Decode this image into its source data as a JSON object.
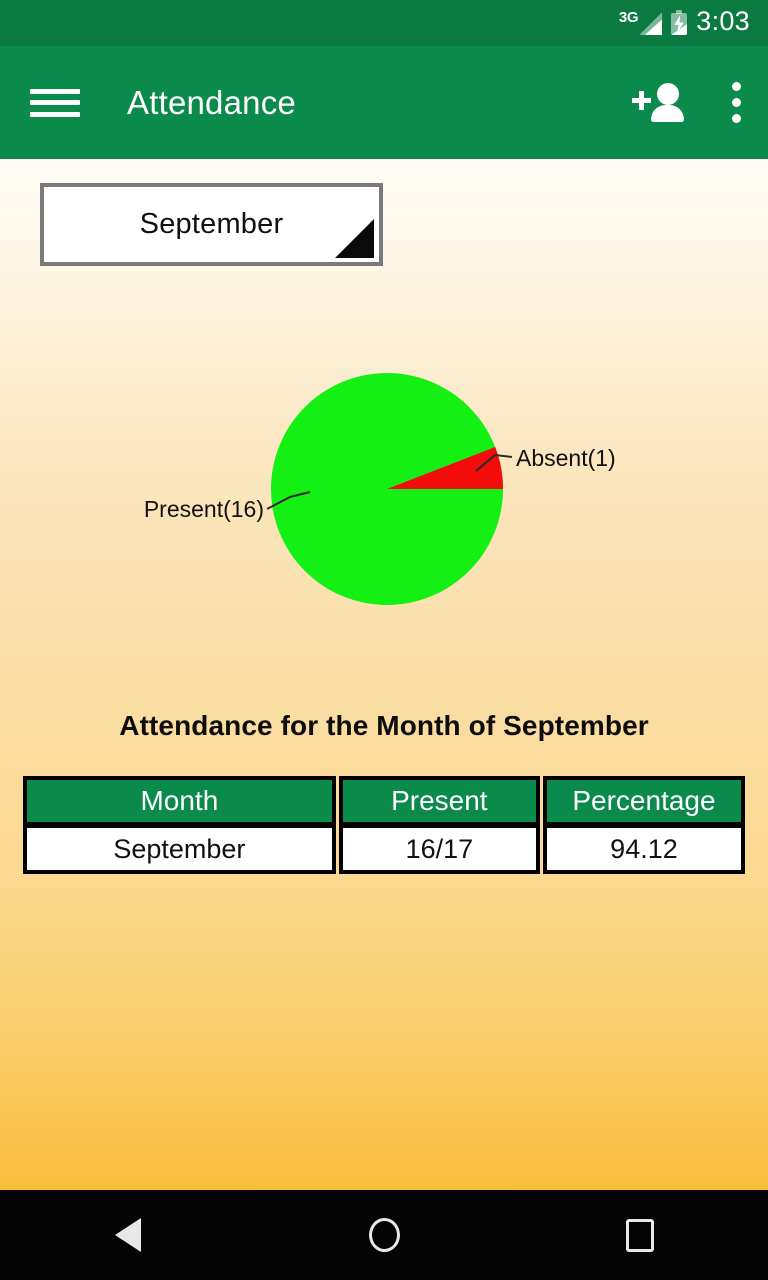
{
  "status_bar": {
    "network_label": "3G",
    "signal_icon": "signal-triangle-icon",
    "battery_icon": "battery-charging-icon",
    "time": "3:03",
    "background_color": "#0A7A41"
  },
  "app_bar": {
    "menu_icon": "hamburger-menu-icon",
    "title": "Attendance",
    "add_person_icon": "add-person-icon",
    "overflow_icon": "overflow-menu-icon",
    "background_color": "#0B8B4B",
    "title_color": "#FFFFFF"
  },
  "spinner": {
    "selected_month": "September",
    "arrow_icon": "dropdown-triangle-icon"
  },
  "chart_data": {
    "type": "pie",
    "title": "",
    "categories": [
      "Present",
      "Absent"
    ],
    "values": [
      16,
      1
    ],
    "labels": [
      "Present(16)",
      "Absent(1)"
    ],
    "colors": [
      "#14F014",
      "#F40C0C"
    ],
    "total": 17,
    "percentages": [
      94.12,
      5.88
    ],
    "legend": "callout-labels",
    "start_angle_deg": 0,
    "direction": "counterclockwise",
    "grid": false
  },
  "summary": {
    "heading": "Attendance for the Month of September"
  },
  "table": {
    "headers": [
      "Month",
      "Present",
      "Percentage"
    ],
    "rows": [
      {
        "month": "September",
        "present": "16/17",
        "percentage": "94.12"
      }
    ],
    "header_bg": "#0B8B4B",
    "header_text_color": "#FFFFFF",
    "cell_bg": "#FFFFFF",
    "border_color": "#000000"
  },
  "background": {
    "gradient_top": "#FFFDF8",
    "gradient_bottom": "#F9BD3B"
  },
  "nav_bar": {
    "back_icon": "back-triangle-icon",
    "home_icon": "home-circle-icon",
    "recents_icon": "recents-square-icon",
    "background_color": "#040404"
  }
}
